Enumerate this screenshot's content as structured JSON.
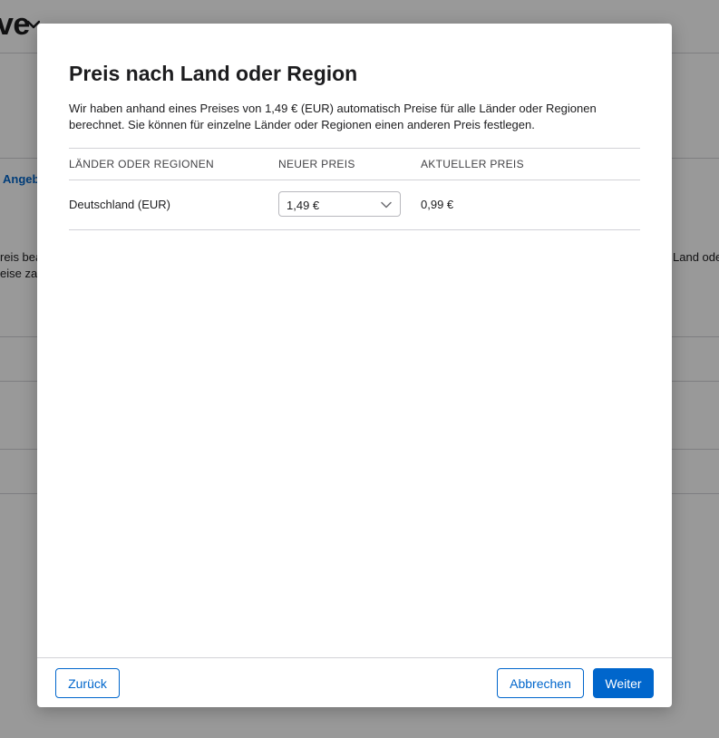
{
  "background": {
    "title": "ve",
    "link": "Angeb",
    "text_left_1": "reis bea",
    "text_left_2": "eise za",
    "text_right": "Land ode"
  },
  "modal": {
    "title": "Preis nach Land oder Region",
    "description": "Wir haben anhand eines Preises von 1,49 € (EUR) automatisch Preise für alle Länder oder Regionen berechnet. Sie können für einzelne Länder oder Regionen einen anderen Preis festlegen.",
    "table": {
      "headers": [
        "LÄNDER ODER REGIONEN",
        "NEUER PREIS",
        "AKTUELLER PREIS"
      ],
      "rows": [
        {
          "country": "Deutschland (EUR)",
          "new_price": "1,49 €",
          "current_price": "0,99 €"
        }
      ]
    },
    "buttons": {
      "back": "Zurück",
      "cancel": "Abbrechen",
      "next": "Weiter"
    }
  },
  "colors": {
    "accent": "#0066cc",
    "overlay": "rgba(0,0,0,0.4)"
  }
}
